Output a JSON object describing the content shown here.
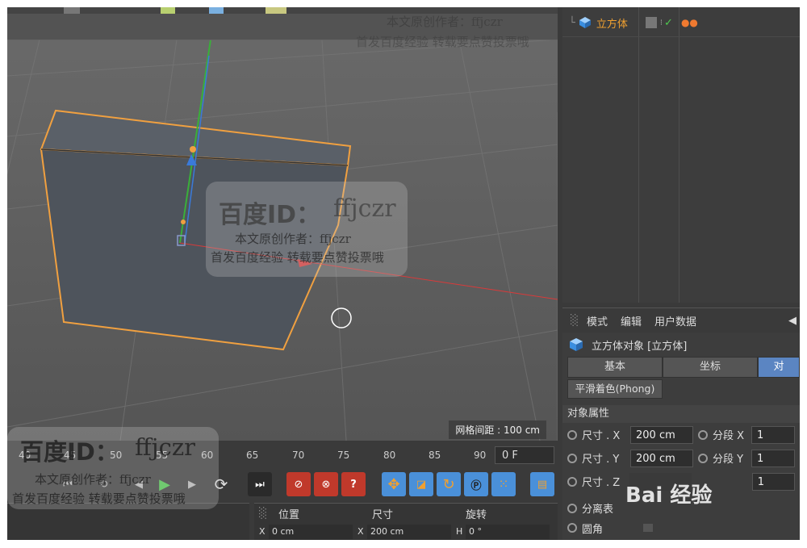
{
  "object_manager": {
    "object_name": "立方体"
  },
  "attributes": {
    "menu": [
      "模式",
      "编辑",
      "用户数据"
    ],
    "title": "立方体对象 [立方体]",
    "tabs": [
      "基本",
      "坐标",
      "对"
    ],
    "phong_tab": "平滑着色(Phong)",
    "section": "对象属性",
    "size_x_label": "尺寸 . X",
    "size_x_value": "200 cm",
    "size_y_label": "尺寸 . Y",
    "size_y_value": "200 cm",
    "size_z_label": "尺寸 . Z",
    "seg_x_label": "分段 X",
    "seg_x_value": "1",
    "seg_y_label": "分段 Y",
    "seg_y_value": "1",
    "seg_z_value": "1",
    "separate_label": "分离表",
    "fillet_label": "圆角"
  },
  "viewport": {
    "grid_spacing": "网格间距 : 100 cm"
  },
  "timeline": {
    "ticks": [
      "40",
      "45",
      "50",
      "55",
      "60",
      "65",
      "70",
      "75",
      "80",
      "85",
      "90"
    ],
    "current_frame": "0 F"
  },
  "coordinates": {
    "position_label": "位置",
    "size_label": "尺寸",
    "rotation_label": "旋转",
    "x_label": "X",
    "x_pos": "0 cm",
    "x_size": "200 cm",
    "h_label": "H",
    "h_rot": "0 °"
  },
  "watermark": {
    "brand": "百度ID：",
    "user": "ffjczr",
    "line1": "本文原创作者：ffjczr",
    "line2": "首发百度经验 转载要点赞投票哦",
    "corner_logo": "Bai 经验"
  },
  "colors": {
    "accent": "#5b85c2",
    "selection_orange": "#f0a040",
    "object_name": "#f0a030",
    "record_red": "#c0392b",
    "tool_blue": "#4a90d9"
  }
}
